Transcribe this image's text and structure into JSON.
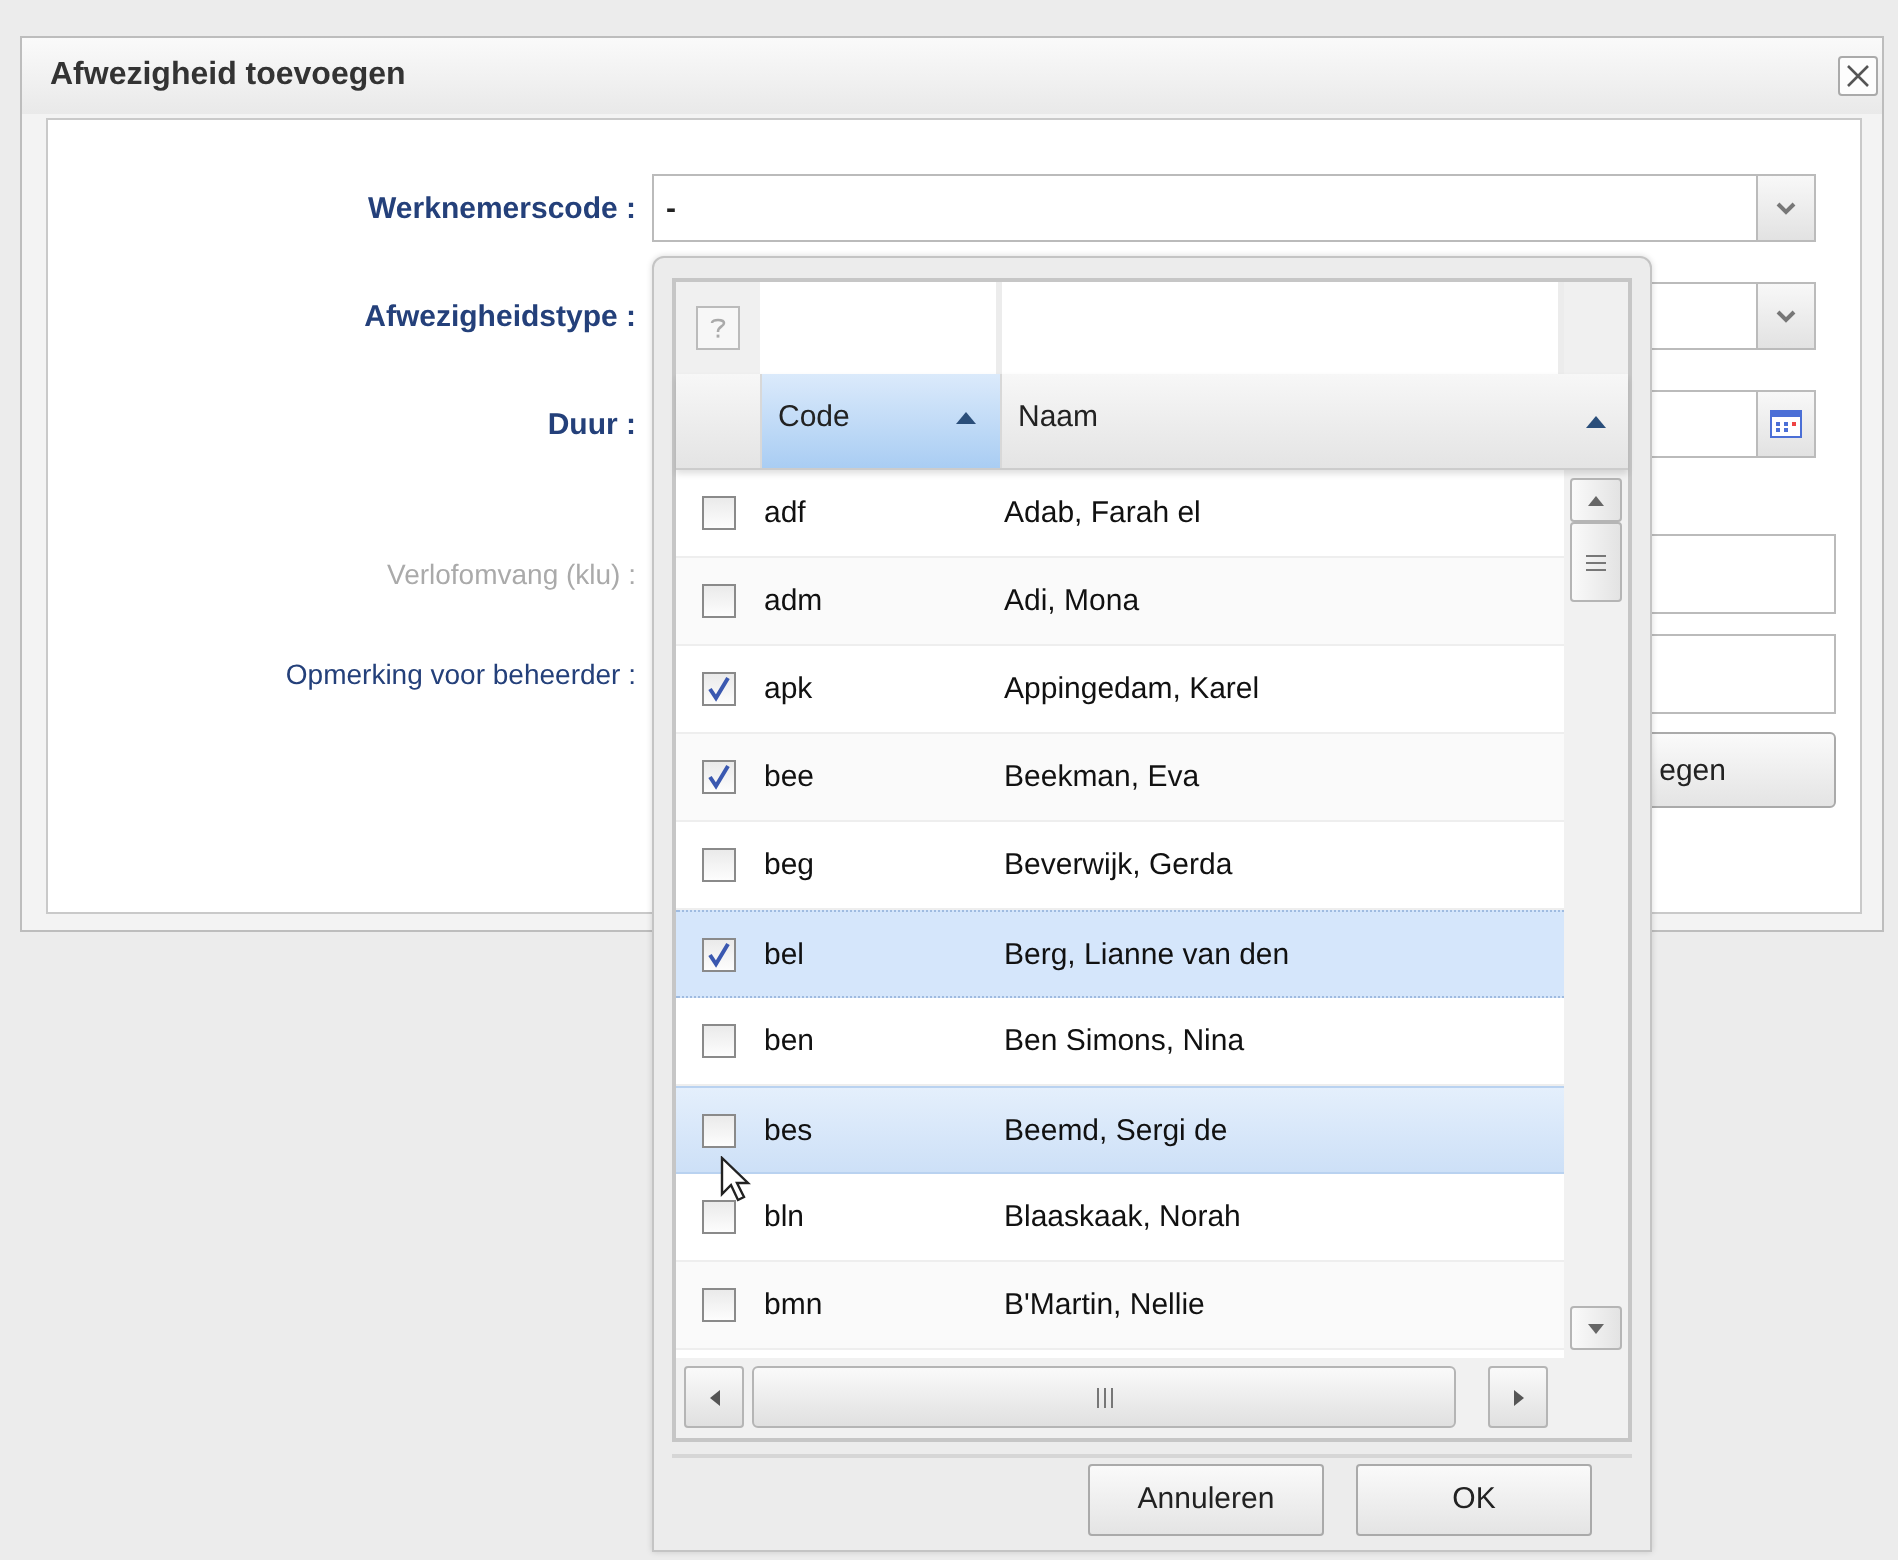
{
  "dialog": {
    "title": "Afwezigheid toevoegen"
  },
  "form": {
    "fields": [
      {
        "label": "Werknemerscode :",
        "kind": "combo",
        "required": true,
        "disabled": false,
        "value": "-"
      },
      {
        "label": "Afwezigheidstype :",
        "kind": "combo",
        "required": true,
        "disabled": false
      },
      {
        "label": "Duur :",
        "kind": "date",
        "required": true,
        "disabled": false
      },
      {
        "label": "Verlofomvang (klu) :",
        "kind": "text",
        "required": false,
        "disabled": true
      },
      {
        "label": "Opmerking voor beheerder :",
        "kind": "text",
        "required": false,
        "disabled": false
      }
    ],
    "button": "egen"
  },
  "picker": {
    "columns": [
      {
        "label": "Code",
        "sorted": true
      },
      {
        "label": "Naam",
        "sorted": false
      }
    ],
    "rows": [
      {
        "code": "adf",
        "name": "Adab, Farah el",
        "checked": false,
        "selected": false,
        "hovered": false
      },
      {
        "code": "adm",
        "name": "Adi, Mona",
        "checked": false,
        "selected": false,
        "hovered": false
      },
      {
        "code": "apk",
        "name": "Appingedam, Karel",
        "checked": true,
        "selected": false,
        "hovered": false
      },
      {
        "code": "bee",
        "name": "Beekman, Eva",
        "checked": true,
        "selected": false,
        "hovered": false
      },
      {
        "code": "beg",
        "name": "Beverwijk, Gerda",
        "checked": false,
        "selected": false,
        "hovered": false
      },
      {
        "code": "bel",
        "name": "Berg, Lianne van den",
        "checked": true,
        "selected": true,
        "hovered": false
      },
      {
        "code": "ben",
        "name": "Ben Simons, Nina",
        "checked": false,
        "selected": false,
        "hovered": false
      },
      {
        "code": "bes",
        "name": "Beemd, Sergi de",
        "checked": false,
        "selected": false,
        "hovered": true
      },
      {
        "code": "bln",
        "name": "Blaaskaak, Norah",
        "checked": false,
        "selected": false,
        "hovered": false
      },
      {
        "code": "bmn",
        "name": "B'Martin, Nellie",
        "checked": false,
        "selected": false,
        "hovered": false
      }
    ],
    "buttons": [
      "Annuleren",
      "OK"
    ]
  }
}
